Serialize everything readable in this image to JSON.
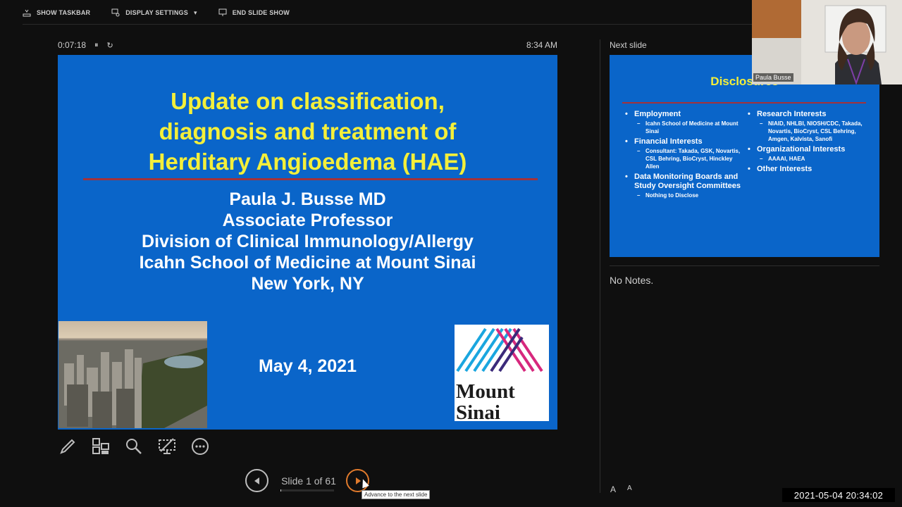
{
  "taskbar": {
    "show_taskbar": "SHOW TASKBAR",
    "display_settings": "DISPLAY SETTINGS",
    "display_settings_caret": "▾",
    "end_slide_show": "END SLIDE SHOW"
  },
  "presenter": {
    "elapsed": "0:07:18",
    "pause_glyph": "⏸",
    "restart_glyph": "↻",
    "clock": "8:34 AM"
  },
  "current_slide": {
    "title_lines": [
      "Update on classification,",
      "diagnosis and treatment of",
      "Herditary Angioedema (HAE)"
    ],
    "author_lines": [
      "Paula J. Busse MD",
      "Associate Professor",
      "Division of Clinical Immunology/Allergy",
      "Icahn School of Medicine at Mount Sinai",
      "New York, NY"
    ],
    "date": "May 4, 2021",
    "logo_lines": [
      "Mount",
      "Sinai"
    ]
  },
  "tools": {
    "pen": "pen-tool",
    "see_all": "see-all-slides",
    "zoom": "zoom-into-slide",
    "black_screen": "black-or-unblack",
    "more": "more-options"
  },
  "navigation": {
    "counter": "Slide 1 of 61",
    "progress_fraction": 0.016,
    "tooltip": "Advance to the next slide"
  },
  "next_panel": {
    "label": "Next slide",
    "title": "Disclosures",
    "left_items": [
      {
        "text": "Employment",
        "subs": [
          "Icahn School of Medicine at Mount Sinai"
        ]
      },
      {
        "text": "Financial Interests",
        "subs": [
          "Consultant: Takada, GSK, Novartis, CSL Behring, BioCryst, Hinckley Allen"
        ]
      },
      {
        "text": "Data Monitoring Boards and Study Oversight Committees",
        "subs": [
          "Nothing to Disclose"
        ]
      }
    ],
    "right_items": [
      {
        "text": "Research Interests",
        "subs": [
          "NIAID, NHLBI, NIOSH/CDC, Takada, Novartis, BioCryst, CSL Behring, Amgen, Kalvista, Sanofi"
        ]
      },
      {
        "text": "Organizational Interests",
        "subs": [
          "AAAAI, HAEA"
        ]
      },
      {
        "text": "Other Interests",
        "subs": []
      }
    ],
    "notes": "No Notes.",
    "font_up": "A",
    "font_down": "A"
  },
  "webcam": {
    "name": "Paula Busse"
  },
  "timestamp": "2021-05-04  20:34:02",
  "colors": {
    "slide_bg": "#0a65c9",
    "title_yellow": "#f4ef3a",
    "rule_red": "#a3323a",
    "next_ring": "#e07a2c"
  }
}
